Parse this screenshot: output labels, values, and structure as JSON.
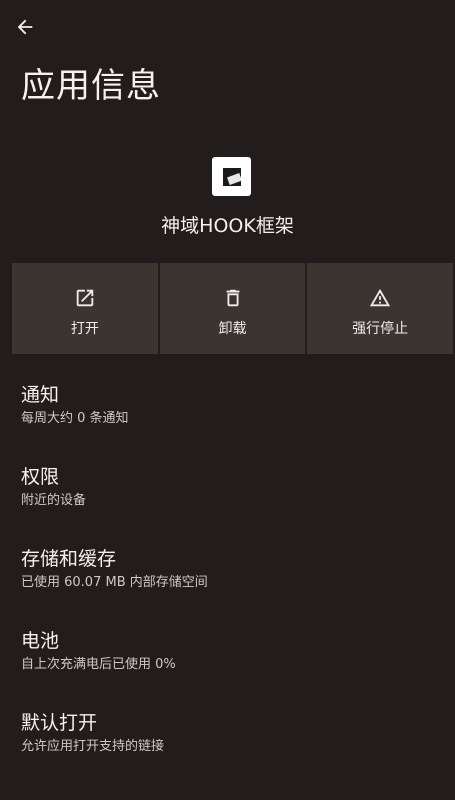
{
  "header": {
    "back_icon": "arrow-back-icon",
    "title": "应用信息"
  },
  "app": {
    "icon": "app-logo-icon",
    "name": "神域HOOK框架"
  },
  "actions": [
    {
      "label": "打开",
      "icon": "open-external-icon"
    },
    {
      "label": "卸载",
      "icon": "trash-icon"
    },
    {
      "label": "强行停止",
      "icon": "warning-icon"
    }
  ],
  "settings": [
    {
      "title": "通知",
      "subtitle": "每周大约 0 条通知"
    },
    {
      "title": "权限",
      "subtitle": "附近的设备"
    },
    {
      "title": "存储和缓存",
      "subtitle": "已使用 60.07 MB 内部存储空间"
    },
    {
      "title": "电池",
      "subtitle": "自上次充满电后已使用 0%"
    },
    {
      "title": "默认打开",
      "subtitle": "允许应用打开支持的链接"
    }
  ],
  "colors": {
    "background": "#221d1c",
    "button_background": "#3b3532",
    "text_primary": "#f5f1ef",
    "text_secondary": "#cfc8c5"
  }
}
